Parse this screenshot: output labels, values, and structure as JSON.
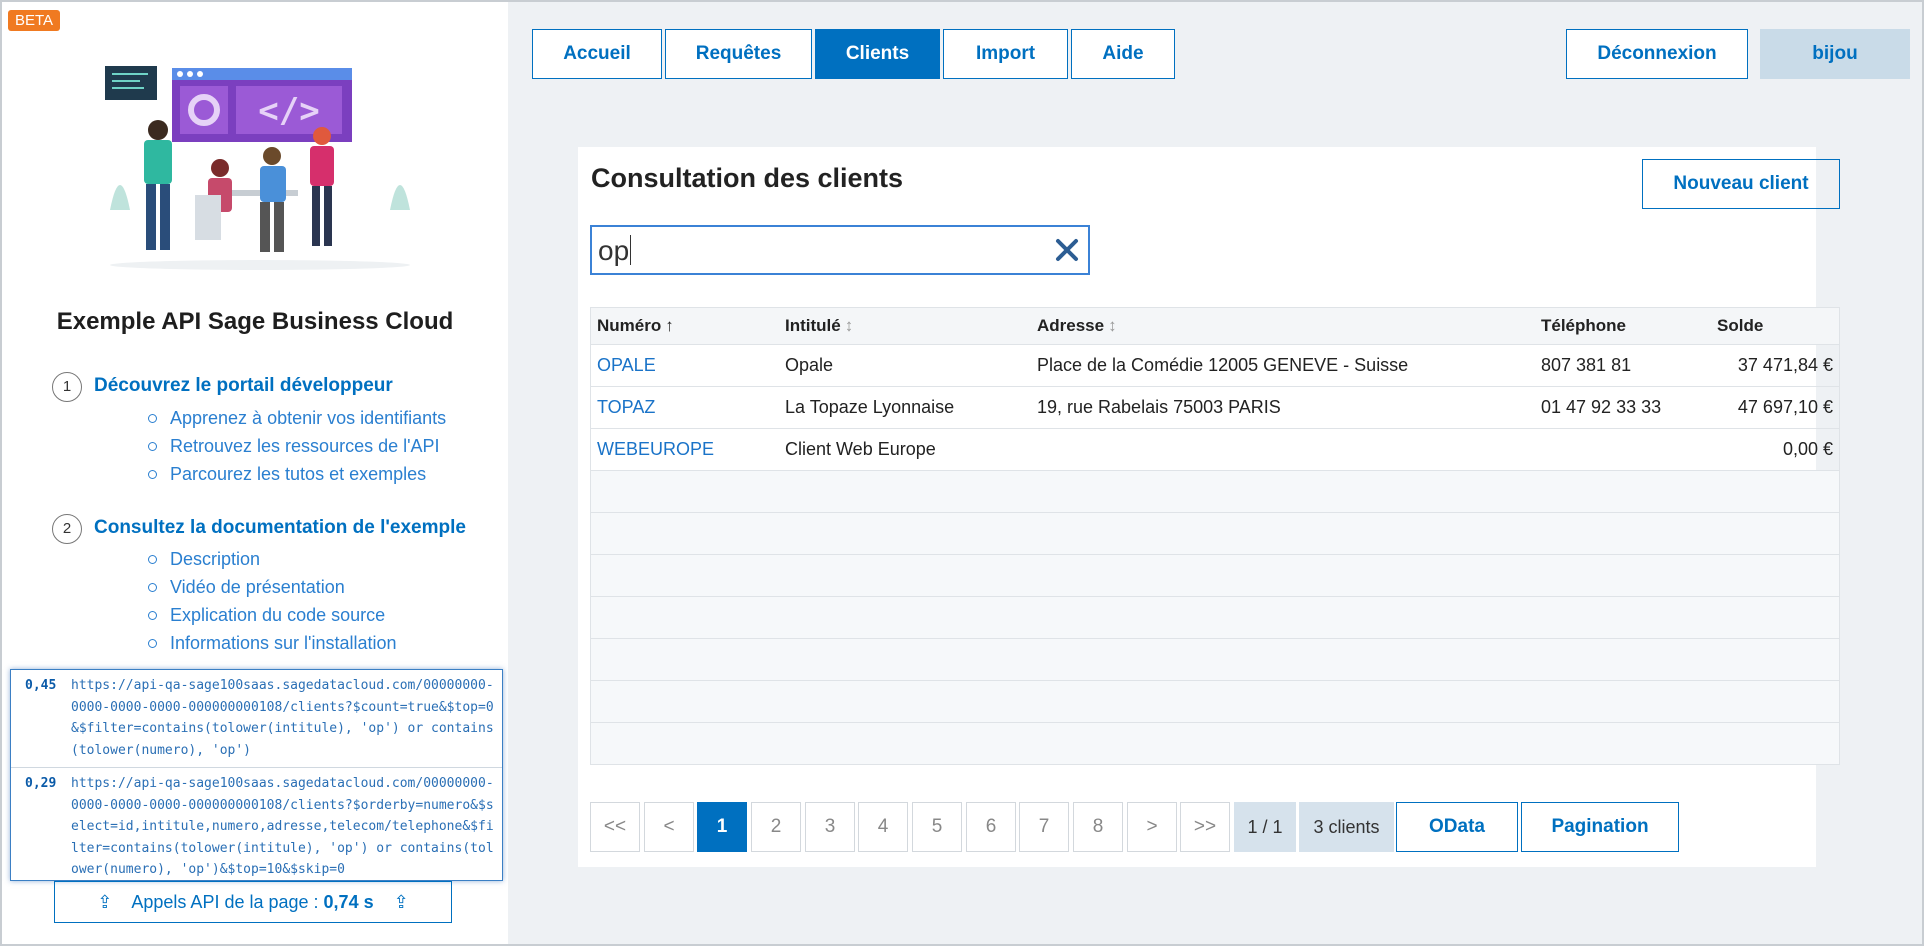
{
  "sidebar": {
    "beta": "BETA",
    "title": "Exemple API Sage Business Cloud",
    "sections": [
      {
        "num": "1",
        "title": "Découvrez le portail développeur",
        "items": [
          "Apprenez à obtenir vos identifiants",
          "Retrouvez les ressources de l'API",
          "Parcourez les tutos et exemples"
        ]
      },
      {
        "num": "2",
        "title": "Consultez la documentation de l'exemple",
        "items": [
          "Description",
          "Vidéo de présentation",
          "Explication du code source",
          "Informations sur l'installation"
        ]
      }
    ],
    "api_calls": [
      {
        "time": "0,45",
        "url": "https://api-qa-sage100saas.sagedatacloud.com/00000000-0000-0000-0000-000000000108/clients?$count=true&$top=0&$filter=contains(tolower(intitule), 'op') or contains(tolower(numero), 'op')"
      },
      {
        "time": "0,29",
        "url": "https://api-qa-sage100saas.sagedatacloud.com/00000000-0000-0000-0000-000000000108/clients?$orderby=numero&$select=id,intitule,numero,adresse,telecom/telephone&$filter=contains(tolower(intitule), 'op') or contains(tolower(numero), 'op')&$top=10&$skip=0"
      }
    ],
    "api_footer": {
      "label": "Appels API de la page :",
      "total": "0,74 s",
      "arrow": "⇪"
    }
  },
  "nav": {
    "tabs": [
      "Accueil",
      "Requêtes",
      "Clients",
      "Import",
      "Aide"
    ],
    "active": "Clients",
    "logout": "Déconnexion",
    "user": "bijou"
  },
  "panel": {
    "title": "Consultation des clients",
    "new_button": "Nouveau client",
    "search_value": "op",
    "columns": [
      "Numéro",
      "Intitulé",
      "Adresse",
      "Téléphone",
      "Solde"
    ],
    "rows": [
      {
        "numero": "OPALE",
        "intitule": "Opale",
        "adresse": "Place de la Comédie 12005 GENEVE - Suisse",
        "telephone": "807 381 81",
        "solde": "37 471,84 €"
      },
      {
        "numero": "TOPAZ",
        "intitule": "La Topaze Lyonnaise",
        "adresse": "19, rue Rabelais 75003 PARIS",
        "telephone": "01 47 92 33 33",
        "solde": "47 697,10 €"
      },
      {
        "numero": "WEBEUROPE",
        "intitule": "Client Web Europe",
        "adresse": "",
        "telephone": "",
        "solde": "0,00 €"
      }
    ]
  },
  "pager": {
    "first": "<<",
    "prev": "<",
    "pages": [
      "1",
      "2",
      "3",
      "4",
      "5",
      "6",
      "7",
      "8"
    ],
    "next": ">",
    "last": ">>",
    "page_info": "1 / 1",
    "count": "3 clients",
    "odata": "OData",
    "pagination": "Pagination"
  },
  "colors": {
    "accent": "#0070c0",
    "beta": "#f07a21"
  }
}
